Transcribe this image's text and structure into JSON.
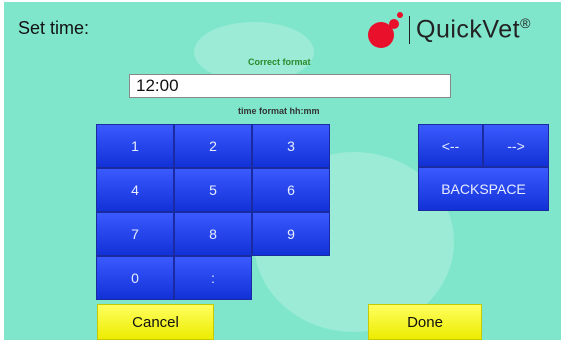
{
  "header": {
    "title": "Set time:"
  },
  "logo": {
    "name": "QuickVet",
    "mark": "®",
    "color": "#e8102a"
  },
  "time_input": {
    "value": "12:00"
  },
  "hints": {
    "correct": "Correct format",
    "format": "time format hh:mm"
  },
  "keypad": {
    "keys": [
      "1",
      "2",
      "3",
      "4",
      "5",
      "6",
      "7",
      "8",
      "9",
      "0",
      ":"
    ]
  },
  "nav": {
    "left": "<--",
    "right": "-->",
    "backspace": "BACKSPACE"
  },
  "actions": {
    "cancel": "Cancel",
    "done": "Done"
  },
  "colors": {
    "background": "#7fe6cc",
    "key": "#1f3cf0",
    "action": "#f6f61e",
    "valid": "#2a8a2a"
  }
}
